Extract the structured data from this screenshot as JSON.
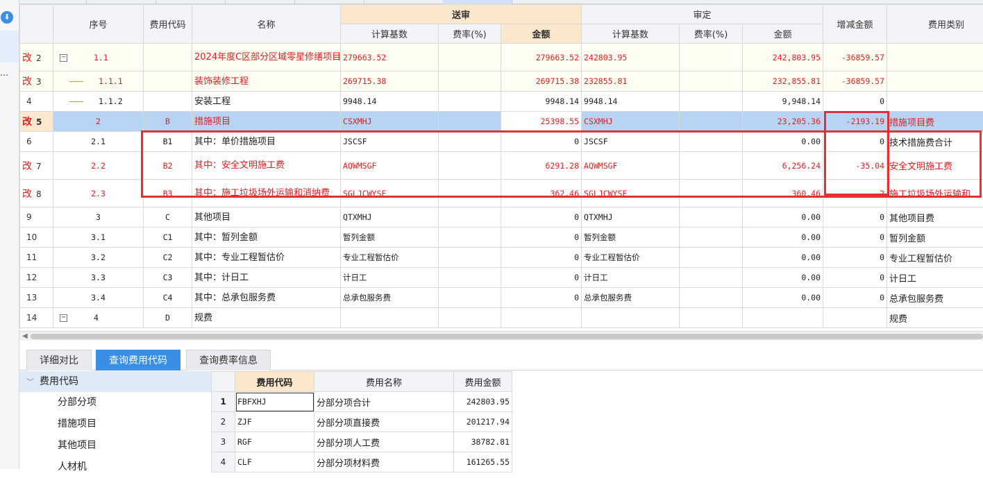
{
  "left_strip": {
    "icon": "download-circle-icon",
    "ellipsis": "…"
  },
  "grid": {
    "headers": {
      "seq": "序号",
      "code": "费用代码",
      "name": "名称",
      "send_group": "送审",
      "audit_group": "审定",
      "base": "计算基数",
      "rate": "费率(%)",
      "amount": "金额",
      "change": "增减金额",
      "category": "费用类别"
    },
    "rows": [
      {
        "row_no": "2",
        "mark": "改",
        "seq": "1.1",
        "code": "",
        "name": "2024年度C区部分区域零星修缮项目",
        "send_base": "279663.52",
        "send_rate": "",
        "send_amount": "279663.52",
        "audit_base": "242803.95",
        "audit_rate": "",
        "audit_amount": "242,803.95",
        "change": "-36859.57",
        "category": "",
        "red": true
      },
      {
        "row_no": "3",
        "mark": "改",
        "seq": "1.1.1",
        "code": "",
        "name": "装饰装修工程",
        "send_base": "269715.38",
        "send_rate": "",
        "send_amount": "269715.38",
        "audit_base": "232855.81",
        "audit_rate": "",
        "audit_amount": "232,855.81",
        "change": "-36859.57",
        "category": "",
        "red": true
      },
      {
        "row_no": "4",
        "mark": "",
        "seq": "1.1.2",
        "code": "",
        "name": "安装工程",
        "send_base": "9948.14",
        "send_rate": "",
        "send_amount": "9948.14",
        "audit_base": "9948.14",
        "audit_rate": "",
        "audit_amount": "9,948.14",
        "change": "0",
        "category": "",
        "red": false
      },
      {
        "row_no": "5",
        "mark": "改",
        "seq": "2",
        "code": "B",
        "name": "措施项目",
        "send_base": "CSXMHJ",
        "send_rate": "",
        "send_amount": "25398.55",
        "audit_base": "CSXMHJ",
        "audit_rate": "",
        "audit_amount": "23,205.36",
        "change": "-2193.19",
        "category": "措施项目费",
        "red": true
      },
      {
        "row_no": "6",
        "mark": "",
        "seq": "2.1",
        "code": "B1",
        "name": "其中：单价措施项目",
        "send_base": "JSCSF",
        "send_rate": "",
        "send_amount": "0",
        "audit_base": "JSCSF",
        "audit_rate": "",
        "audit_amount": "0.00",
        "change": "0",
        "category": "技术措施费合计",
        "red": false
      },
      {
        "row_no": "7",
        "mark": "改",
        "seq": "2.2",
        "code": "B2",
        "name": "其中：安全文明施工费",
        "send_base": "AQWMSGF",
        "send_rate": "",
        "send_amount": "6291.28",
        "audit_base": "AQWMSGF",
        "audit_rate": "",
        "audit_amount": "6,256.24",
        "change": "-35.04",
        "category": "安全文明施工费",
        "red": true
      },
      {
        "row_no": "8",
        "mark": "改",
        "seq": "2.3",
        "code": "B3",
        "name": "其中：施工垃圾场外运输和消纳费",
        "send_base": "SGLJCWYSF",
        "send_rate": "",
        "send_amount": "362.46",
        "audit_base": "SGLJCWYSF",
        "audit_rate": "",
        "audit_amount": "360.46",
        "change": "-2",
        "category": "施工垃圾场外运输和",
        "red": true
      },
      {
        "row_no": "9",
        "mark": "",
        "seq": "3",
        "code": "C",
        "name": "其他项目",
        "send_base": "QTXMHJ",
        "send_rate": "",
        "send_amount": "0",
        "audit_base": "QTXMHJ",
        "audit_rate": "",
        "audit_amount": "0.00",
        "change": "0",
        "category": "其他项目费",
        "red": false
      },
      {
        "row_no": "10",
        "mark": "",
        "seq": "3.1",
        "code": "C1",
        "name": "其中：暂列金额",
        "send_base": "暂列金额",
        "send_rate": "",
        "send_amount": "0",
        "audit_base": "暂列金额",
        "audit_rate": "",
        "audit_amount": "0.00",
        "change": "0",
        "category": "暂列金额",
        "red": false
      },
      {
        "row_no": "11",
        "mark": "",
        "seq": "3.2",
        "code": "C2",
        "name": "其中：专业工程暂估价",
        "send_base": "专业工程暂估价",
        "send_rate": "",
        "send_amount": "0",
        "audit_base": "专业工程暂估价",
        "audit_rate": "",
        "audit_amount": "0.00",
        "change": "0",
        "category": "专业工程暂估价",
        "red": false
      },
      {
        "row_no": "12",
        "mark": "",
        "seq": "3.3",
        "code": "C3",
        "name": "其中：计日工",
        "send_base": "计日工",
        "send_rate": "",
        "send_amount": "0",
        "audit_base": "计日工",
        "audit_rate": "",
        "audit_amount": "0.00",
        "change": "0",
        "category": "计日工",
        "red": false
      },
      {
        "row_no": "13",
        "mark": "",
        "seq": "3.4",
        "code": "C4",
        "name": "其中：总承包服务费",
        "send_base": "总承包服务费",
        "send_rate": "",
        "send_amount": "0",
        "audit_base": "总承包服务费",
        "audit_rate": "",
        "audit_amount": "0.00",
        "change": "0",
        "category": "总承包服务费",
        "red": false
      },
      {
        "row_no": "14",
        "mark": "",
        "seq": "4",
        "code": "D",
        "name": "规费",
        "send_base": "",
        "send_rate": "",
        "send_amount": "",
        "audit_base": "",
        "audit_rate": "",
        "audit_amount": "",
        "change": "",
        "category": "规费",
        "red": false
      }
    ]
  },
  "bottom_tabs": [
    {
      "label": "详细对比",
      "active": false
    },
    {
      "label": "查询费用代码",
      "active": true
    },
    {
      "label": "查询费率信息",
      "active": false
    }
  ],
  "tree": {
    "root": "费用代码",
    "items": [
      "分部分项",
      "措施项目",
      "其他项目",
      "人材机"
    ]
  },
  "codes_table": {
    "headers": {
      "code": "费用代码",
      "name": "费用名称",
      "amount": "费用金额"
    },
    "rows": [
      {
        "idx": "1",
        "code": "FBFXHJ",
        "name": "分部分项合计",
        "amount": "242803.95"
      },
      {
        "idx": "2",
        "code": "ZJF",
        "name": "分部分项直接费",
        "amount": "201217.94"
      },
      {
        "idx": "3",
        "code": "RGF",
        "name": "分部分项人工费",
        "amount": "38782.81"
      },
      {
        "idx": "4",
        "code": "CLF",
        "name": "分部分项材料费",
        "amount": "161265.55"
      }
    ]
  },
  "colors": {
    "accent": "#3a8ee6",
    "modified": "#e02020",
    "send_header": "#fbe7cc",
    "highlight_box": "#e53030"
  }
}
